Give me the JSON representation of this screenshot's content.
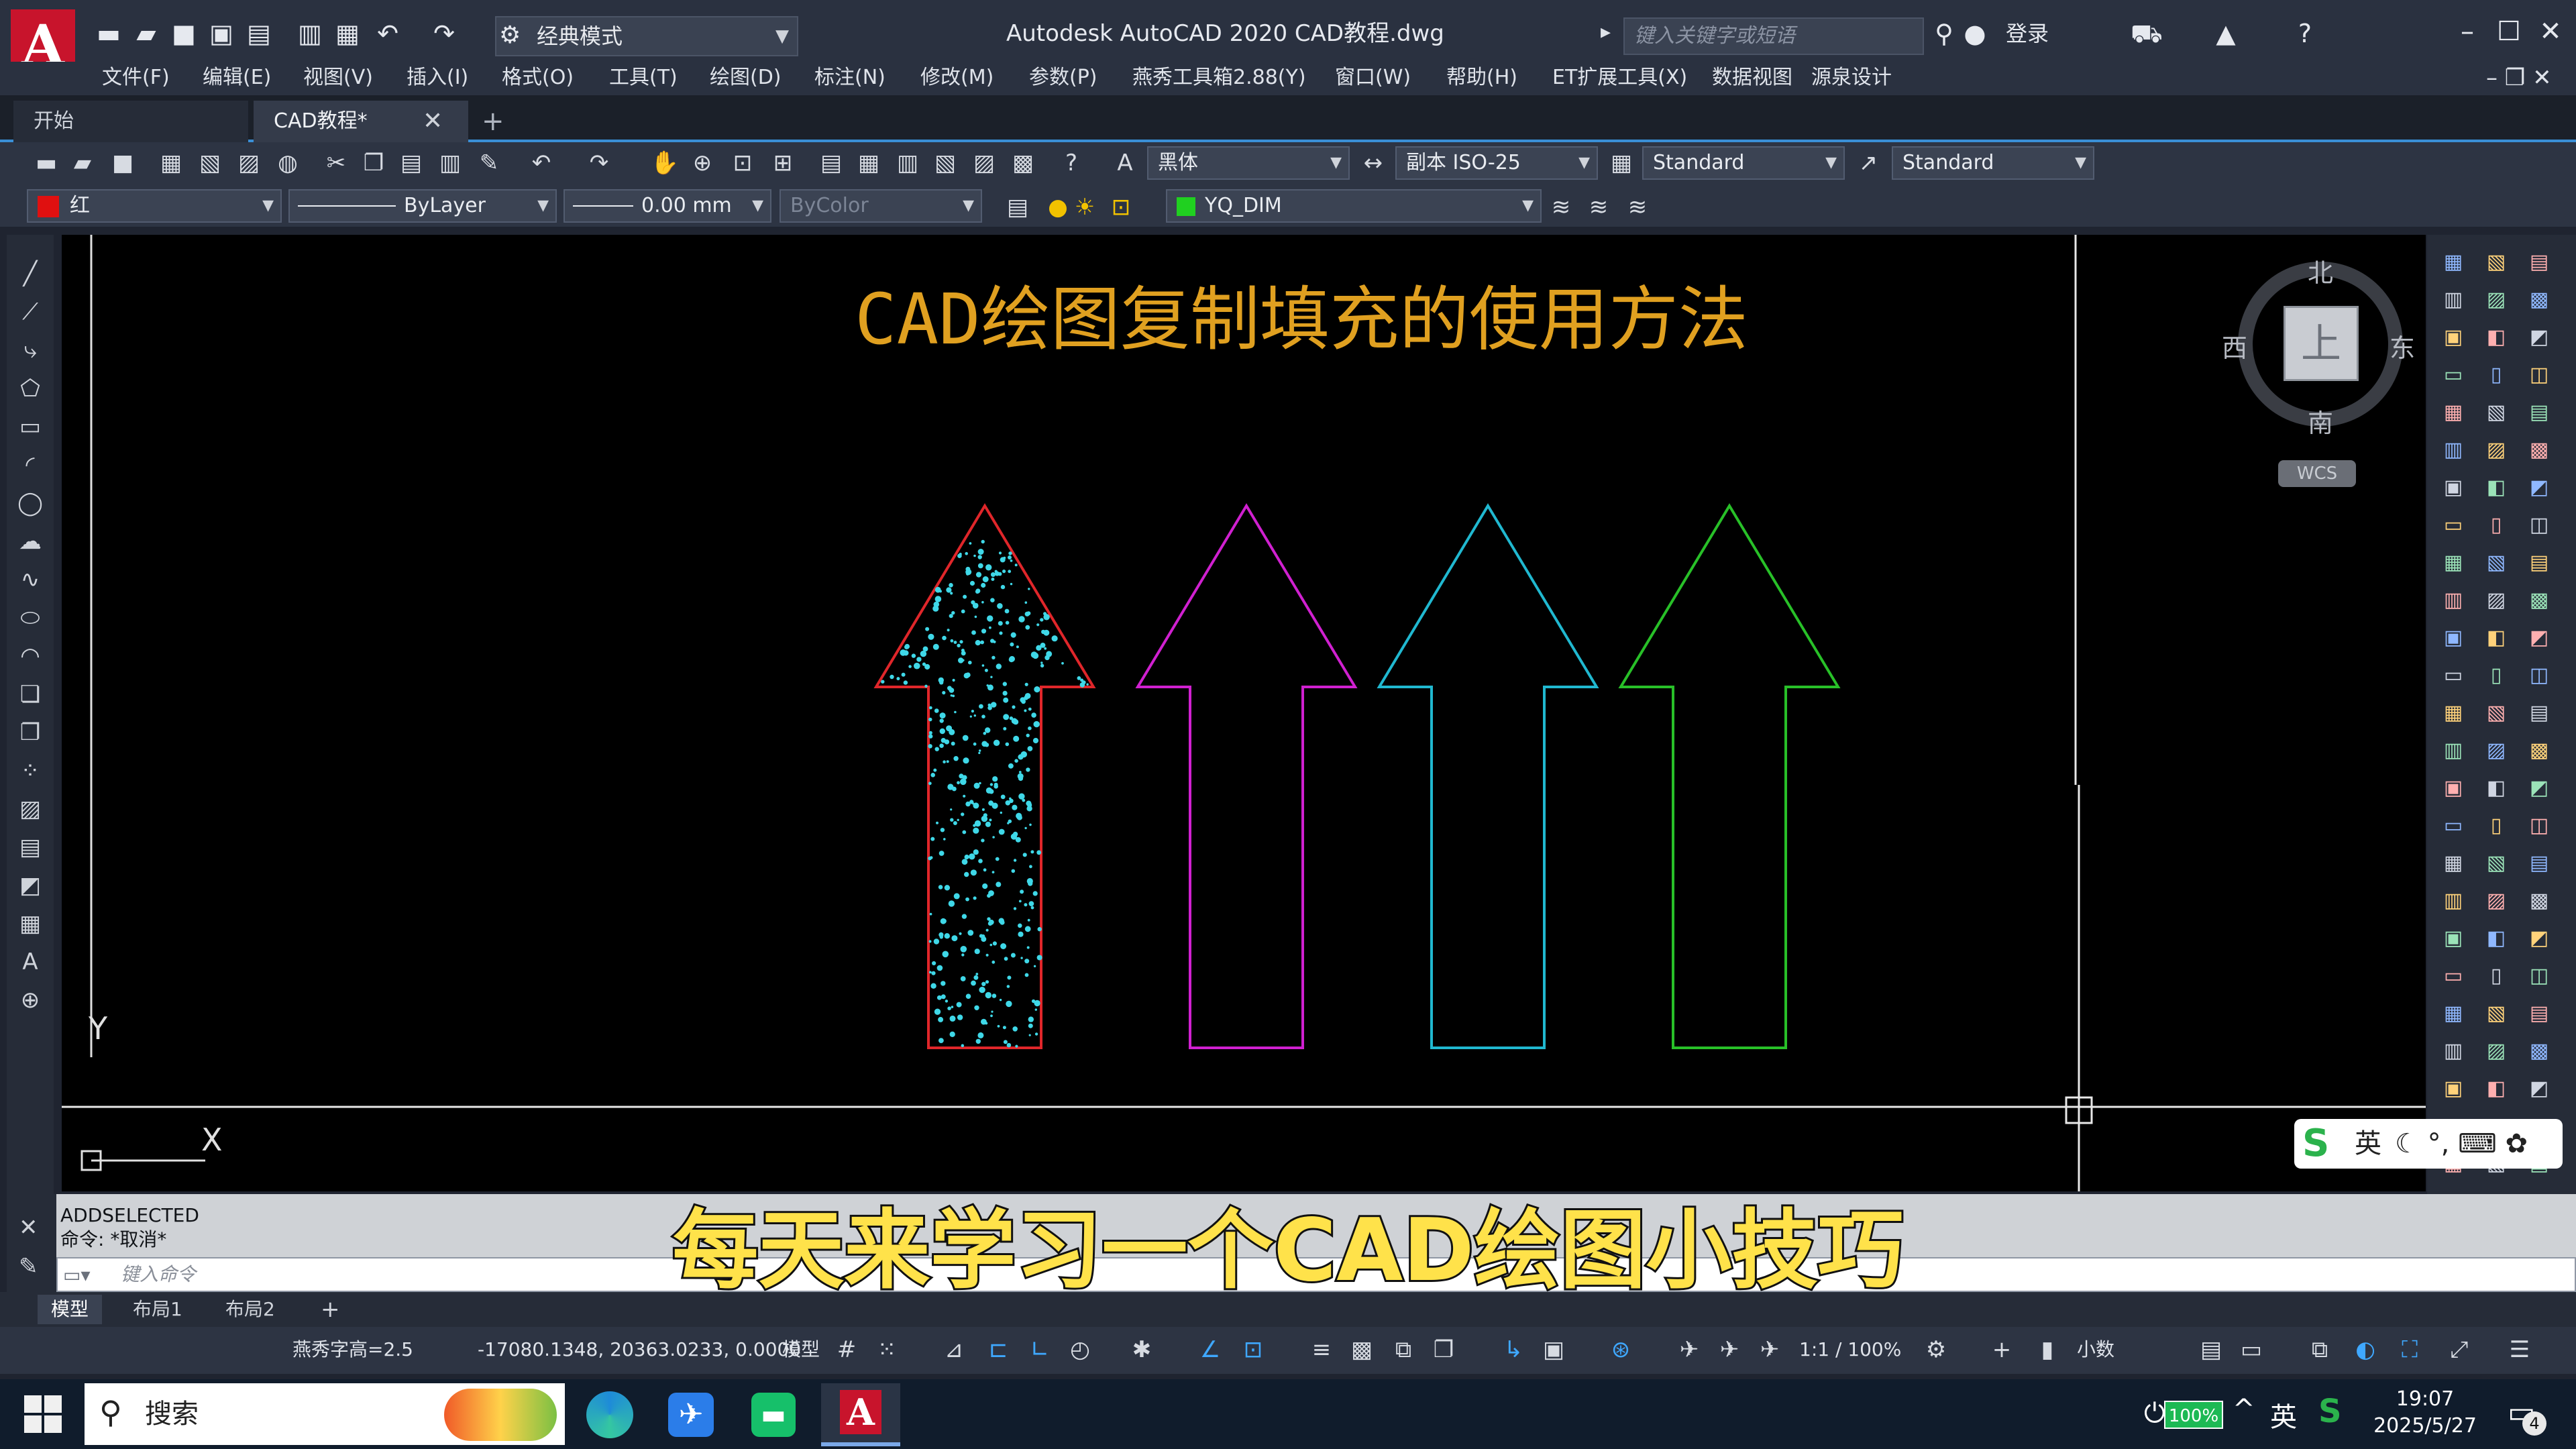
{
  "titlebar": {
    "workspace": "经典模式",
    "app_title": "Autodesk AutoCAD 2020    CAD教程.dwg",
    "search_placeholder": "键入关键字或短语",
    "login": "登录"
  },
  "menu": [
    "文件(F)",
    "编辑(E)",
    "视图(V)",
    "插入(I)",
    "格式(O)",
    "工具(T)",
    "绘图(D)",
    "标注(N)",
    "修改(M)",
    "参数(P)",
    "燕秀工具箱2.88(Y)",
    "窗口(W)",
    "帮助(H)",
    "ET扩展工具(X)",
    "数据视图",
    "源泉设计"
  ],
  "tabs": {
    "start": "开始",
    "doc": "CAD教程*"
  },
  "toolbar1": {
    "text_style": "黑体",
    "dim_style": "副本 ISO-25",
    "table_style": "Standard",
    "mleader_style": "Standard"
  },
  "toolbar2": {
    "color": "红",
    "linetype": "ByLayer",
    "lineweight": "0.00 mm",
    "plotstyle": "ByColor",
    "layer": "YQ_DIM"
  },
  "colors": {
    "layer_red": "#e01010",
    "layer_green": "#20d020",
    "arrow1": "#e0262a",
    "arrow2": "#d020d0",
    "arrow3": "#20b8d0",
    "arrow4": "#28c028",
    "hatch": "#3fd8e8",
    "title": "#e0a020"
  },
  "drawing": {
    "title": "CAD绘图复制填充的使用方法",
    "viewcube": {
      "north": "北",
      "south": "南",
      "east": "东",
      "west": "西",
      "face": "上",
      "wcs": "WCS"
    },
    "ucs": {
      "y": "Y",
      "x": "X"
    }
  },
  "command": {
    "history": [
      "ADDSELECTED",
      "命令: *取消*"
    ],
    "placeholder": "键入命令"
  },
  "subtitle": "每天来学习一个CAD绘图小技巧",
  "layout_tabs": [
    "模型",
    "布局1",
    "布局2"
  ],
  "status": {
    "plugin": "燕秀字高=2.5",
    "coords": "-17080.1348, 20363.0233, 0.0000",
    "mode": "模型",
    "scale": "1:1 / 100%",
    "units": "小数"
  },
  "ime": {
    "lang": "英"
  },
  "taskbar": {
    "search": "搜索",
    "battery": "100%",
    "lang": "英",
    "time": "19:07",
    "date": "2025/5/27",
    "notif_count": "4"
  }
}
